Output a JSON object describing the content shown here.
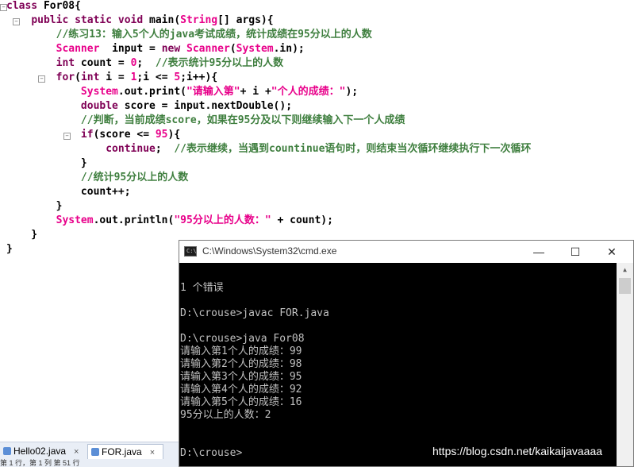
{
  "editor": {
    "lines": [
      {
        "parts": [
          {
            "c": "kw",
            "t": "class "
          },
          {
            "c": "",
            "t": "For08{"
          }
        ]
      },
      {
        "parts": [
          {
            "c": "",
            "t": "    "
          },
          {
            "c": "kw",
            "t": "public static void "
          },
          {
            "c": "",
            "t": "main("
          },
          {
            "c": "ty",
            "t": "String"
          },
          {
            "c": "",
            "t": "[] args){"
          }
        ]
      },
      {
        "parts": [
          {
            "c": "",
            "t": "        "
          },
          {
            "c": "cm",
            "t": "//练习13：输入5个人的java考试成绩，统计成绩在95分以上的人数"
          }
        ]
      },
      {
        "parts": [
          {
            "c": "",
            "t": "        "
          },
          {
            "c": "ty",
            "t": "Scanner"
          },
          {
            "c": "",
            "t": "  input = "
          },
          {
            "c": "kw",
            "t": "new "
          },
          {
            "c": "ty",
            "t": "Scanner"
          },
          {
            "c": "",
            "t": "("
          },
          {
            "c": "ty",
            "t": "System"
          },
          {
            "c": "",
            "t": ".in);"
          }
        ]
      },
      {
        "parts": [
          {
            "c": "",
            "t": "        "
          },
          {
            "c": "kw",
            "t": "int"
          },
          {
            "c": "",
            "t": " count = "
          },
          {
            "c": "st",
            "t": "0"
          },
          {
            "c": "",
            "t": ";  "
          },
          {
            "c": "cm",
            "t": "//表示统计95分以上的人数"
          }
        ]
      },
      {
        "parts": [
          {
            "c": "",
            "t": "        "
          },
          {
            "c": "kw",
            "t": "for"
          },
          {
            "c": "",
            "t": "("
          },
          {
            "c": "kw",
            "t": "int"
          },
          {
            "c": "",
            "t": " i = "
          },
          {
            "c": "st",
            "t": "1"
          },
          {
            "c": "",
            "t": ";i <= "
          },
          {
            "c": "st",
            "t": "5"
          },
          {
            "c": "",
            "t": ";i++){"
          }
        ]
      },
      {
        "parts": [
          {
            "c": "",
            "t": "            "
          },
          {
            "c": "ty",
            "t": "System"
          },
          {
            "c": "",
            "t": ".out.print("
          },
          {
            "c": "st",
            "t": "\"请输入第\""
          },
          {
            "c": "",
            "t": "+ i +"
          },
          {
            "c": "st",
            "t": "\"个人的成绩：\""
          },
          {
            "c": "",
            "t": ");"
          }
        ]
      },
      {
        "parts": [
          {
            "c": "",
            "t": "            "
          },
          {
            "c": "kw",
            "t": "double"
          },
          {
            "c": "",
            "t": " score = input.nextDouble();"
          }
        ]
      },
      {
        "parts": [
          {
            "c": "",
            "t": "            "
          },
          {
            "c": "cm",
            "t": "//判断，当前成绩score，如果在95分及以下则继续输入下一个人成绩"
          }
        ]
      },
      {
        "parts": [
          {
            "c": "",
            "t": "            "
          },
          {
            "c": "kw",
            "t": "if"
          },
          {
            "c": "",
            "t": "(score <= "
          },
          {
            "c": "st",
            "t": "95"
          },
          {
            "c": "",
            "t": "){"
          }
        ]
      },
      {
        "parts": [
          {
            "c": "",
            "t": "                "
          },
          {
            "c": "kw",
            "t": "continue"
          },
          {
            "c": "",
            "t": ";  "
          },
          {
            "c": "cm",
            "t": "//表示继续，当遇到countinue语句时，则结束当次循环继续执行下一次循环"
          }
        ]
      },
      {
        "parts": [
          {
            "c": "",
            "t": "            }"
          }
        ]
      },
      {
        "parts": [
          {
            "c": "",
            "t": "            "
          },
          {
            "c": "cm",
            "t": "//统计95分以上的人数"
          }
        ]
      },
      {
        "parts": [
          {
            "c": "",
            "t": "            count++;"
          }
        ]
      },
      {
        "parts": [
          {
            "c": "",
            "t": "        }"
          }
        ]
      },
      {
        "parts": [
          {
            "c": "",
            "t": "        "
          },
          {
            "c": "ty",
            "t": "System"
          },
          {
            "c": "",
            "t": ".out.println("
          },
          {
            "c": "st",
            "t": "\"95分以上的人数：\""
          },
          {
            "c": "",
            "t": " + count);"
          }
        ]
      },
      {
        "parts": [
          {
            "c": "",
            "t": "    }"
          }
        ]
      },
      {
        "parts": [
          {
            "c": "",
            "t": "}"
          }
        ]
      }
    ]
  },
  "tabs": {
    "items": [
      {
        "label": "Hello02.java",
        "close": "×"
      },
      {
        "label": "FOR.java",
        "close": "×"
      }
    ]
  },
  "statusbar": {
    "text": "第 1 行，第 1 列  第 51 行"
  },
  "cmd": {
    "title": "C:\\Windows\\System32\\cmd.exe",
    "icon_text": "C:\\",
    "minimize_glyph": "—",
    "maximize_glyph": "☐",
    "close_glyph": "✕",
    "lines": [
      "^",
      "",
      "1 个错误",
      "",
      "D:\\crouse>javac FOR.java",
      "",
      "D:\\crouse>java For08",
      "请输入第1个人的成绩：99",
      "请输入第2个人的成绩：98",
      "请输入第3个人的成绩：95",
      "请输入第4个人的成绩：92",
      "请输入第5个人的成绩：16",
      "95分以上的人数：2",
      "",
      "",
      "D:\\crouse>"
    ]
  },
  "watermark": "https://blog.csdn.net/kaikaijavaaaa",
  "icons": {
    "fold": "minus-box-icon",
    "cmd": "console-icon",
    "java": "java-file-icon"
  }
}
